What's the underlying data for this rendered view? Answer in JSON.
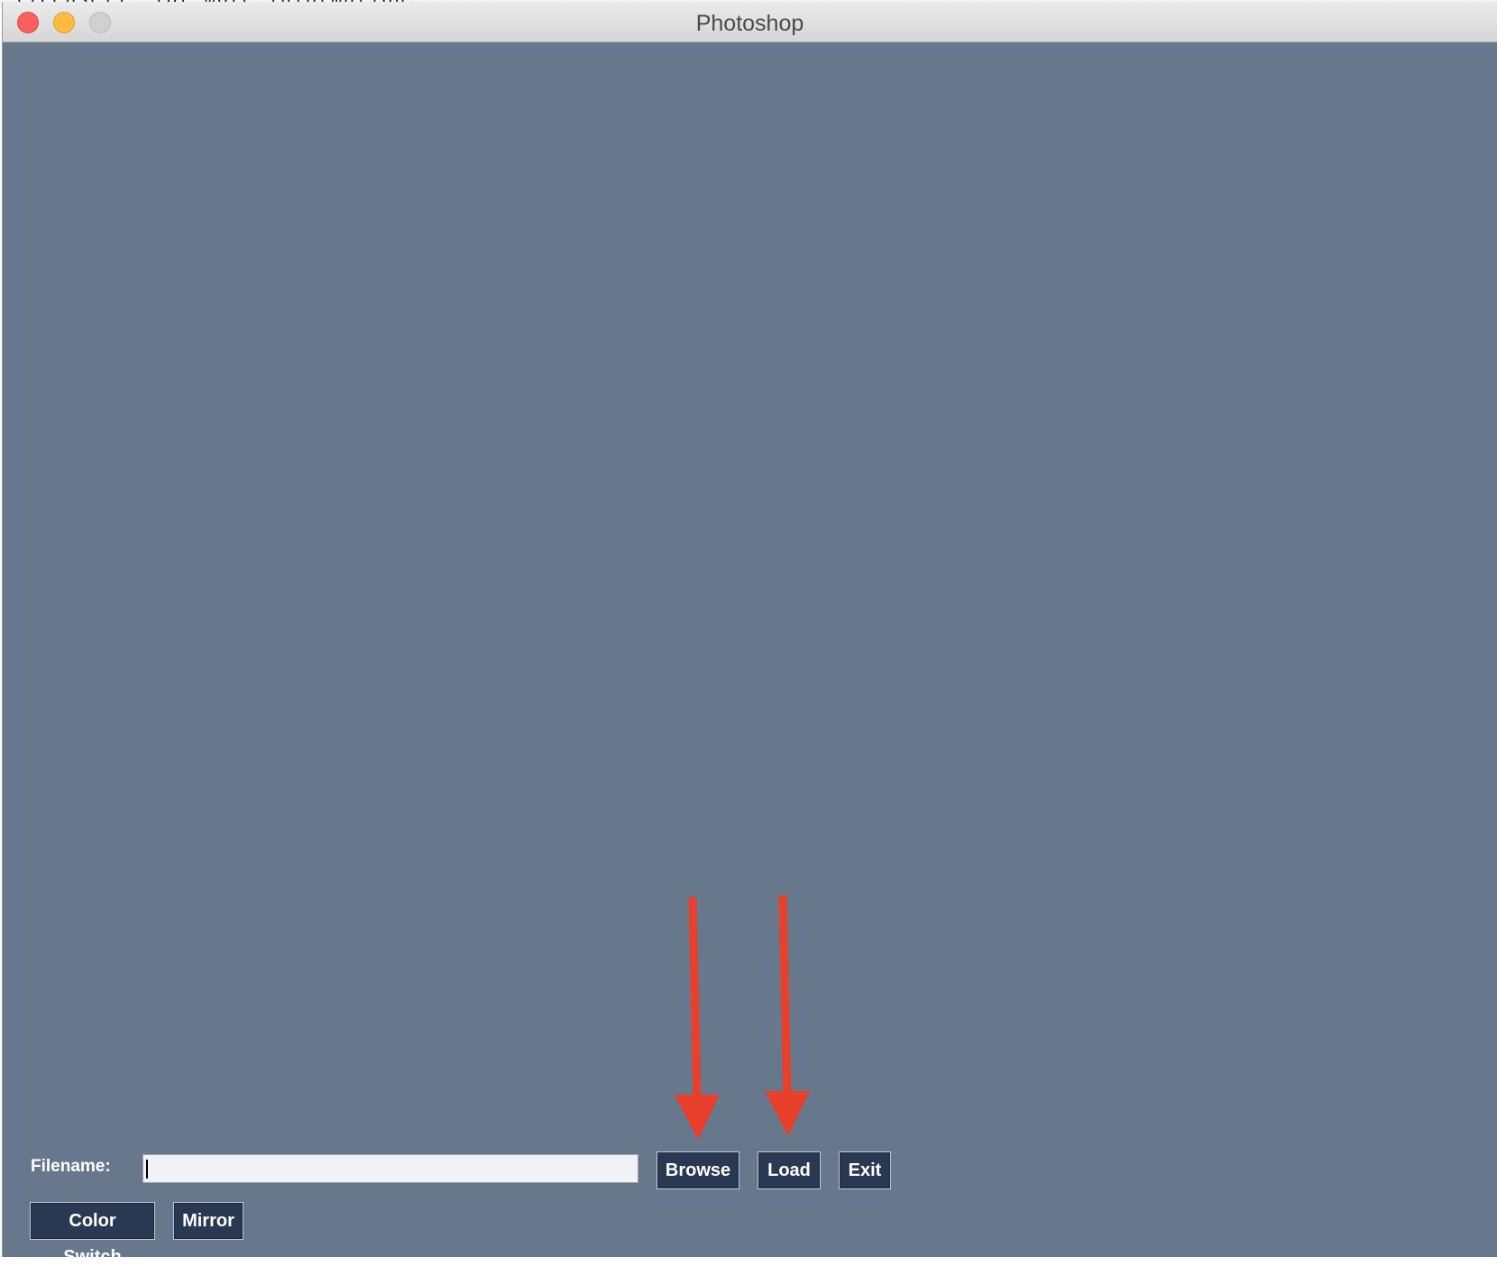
{
  "window": {
    "title": "Photoshop"
  },
  "form": {
    "filename_label": "Filename:",
    "filename_value": ""
  },
  "buttons": {
    "browse": "Browse",
    "load": "Load",
    "exit": "Exit",
    "color_switch": "Color Switch",
    "mirror": "Mirror"
  },
  "colors": {
    "canvas_background": "#67778c",
    "button_background": "#2a3953",
    "annotation_arrow": "#e8402a"
  },
  "annotations": [
    {
      "name": "arrow-to-browse",
      "icon": "down-arrow-icon"
    },
    {
      "name": "arrow-to-load",
      "icon": "down-arrow-icon"
    }
  ]
}
